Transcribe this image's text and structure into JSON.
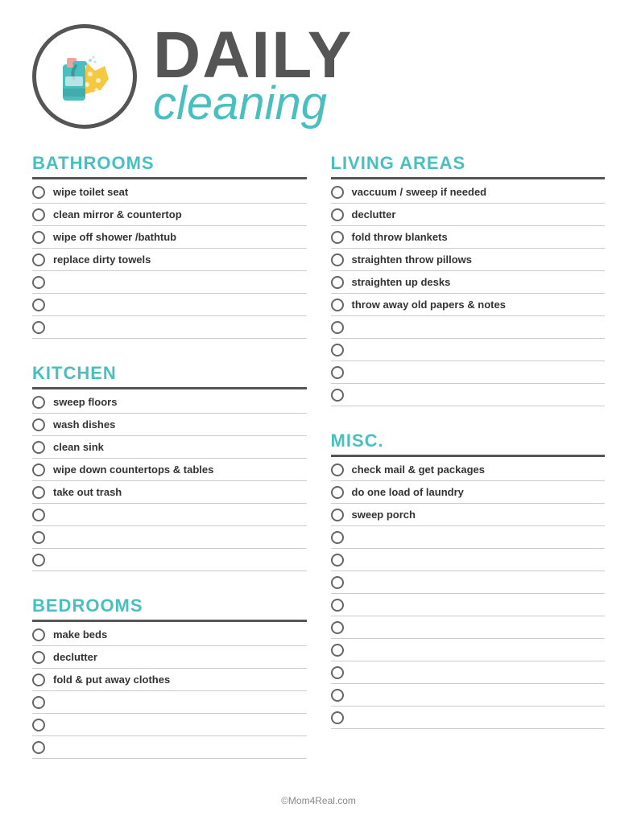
{
  "header": {
    "title_daily": "DAILY",
    "title_cleaning": "cleaning"
  },
  "sections": {
    "bathrooms": {
      "title": "BATHROOMS",
      "items": [
        "wipe toilet seat",
        "clean mirror & countertop",
        "wipe off shower /bathtub",
        "replace dirty towels",
        "",
        "",
        ""
      ]
    },
    "kitchen": {
      "title": "KITCHEN",
      "items": [
        "sweep floors",
        "wash dishes",
        "clean sink",
        "wipe down countertops & tables",
        "take out trash",
        "",
        "",
        ""
      ]
    },
    "bedrooms": {
      "title": "BEDROOMS",
      "items": [
        "make beds",
        "declutter",
        "fold & put away clothes",
        "",
        "",
        ""
      ]
    },
    "living_areas": {
      "title": "LIVING AREAS",
      "items": [
        "vaccuum / sweep if needed",
        "declutter",
        "fold throw blankets",
        "straighten throw pillows",
        "straighten up desks",
        "throw away old papers & notes",
        "",
        "",
        "",
        ""
      ]
    },
    "misc": {
      "title": "MISC.",
      "items": [
        "check mail & get packages",
        "do one load of laundry",
        "sweep porch",
        "",
        "",
        "",
        "",
        "",
        "",
        "",
        "",
        ""
      ]
    }
  },
  "footer": {
    "text": "©Mom4Real.com"
  }
}
